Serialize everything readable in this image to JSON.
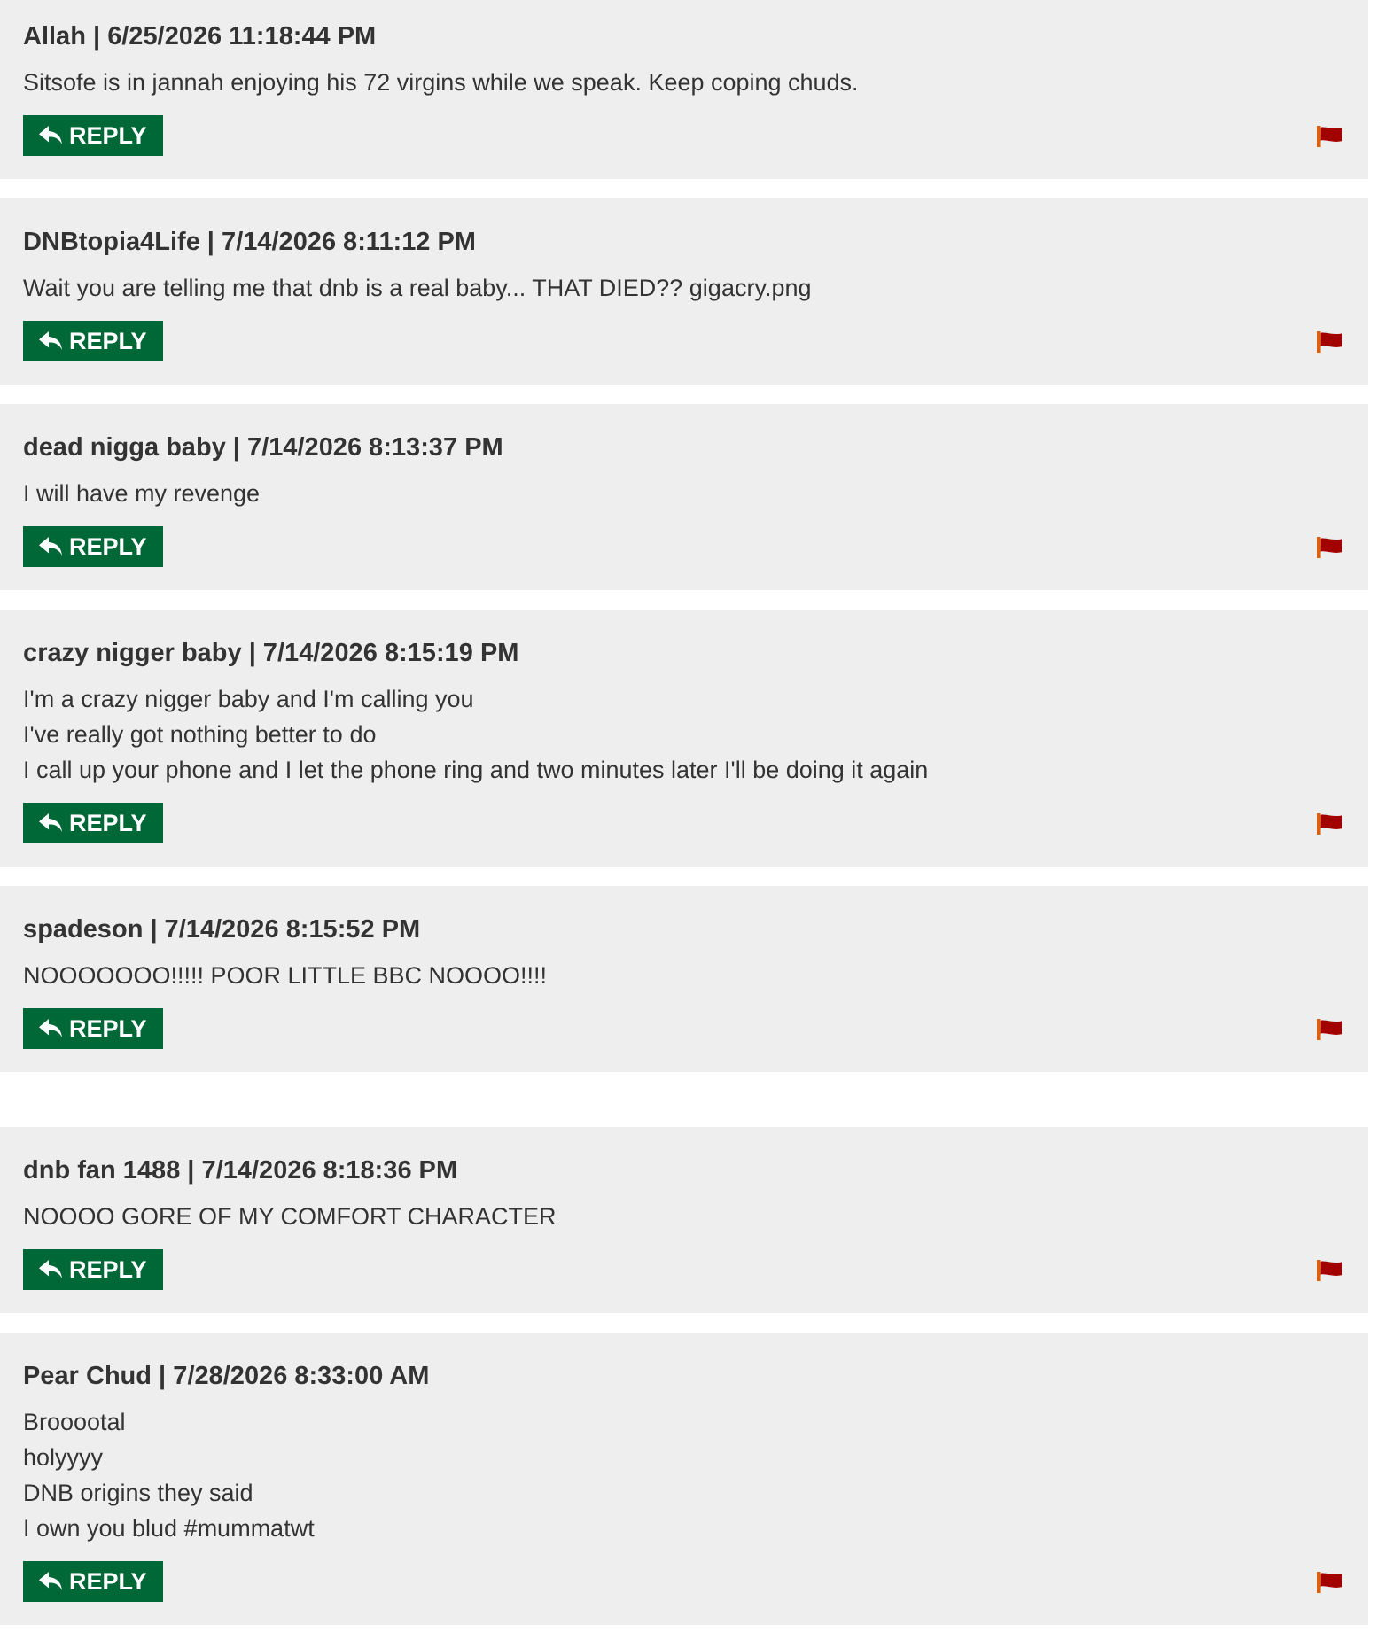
{
  "comments": [
    {
      "header": "Allah | 6/25/2026 11:18:44 PM",
      "lines": [
        "Sitsofe is in jannah enjoying his 72 virgins while we speak. Keep coping chuds."
      ],
      "reply_label": "REPLY"
    },
    {
      "header": "DNBtopia4Life | 7/14/2026 8:11:12 PM",
      "lines": [
        "Wait you are telling me that dnb is a real baby... THAT DIED?? gigacry.png"
      ],
      "reply_label": "REPLY"
    },
    {
      "header": "dead nigga baby | 7/14/2026 8:13:37 PM",
      "lines": [
        "I will have my revenge"
      ],
      "reply_label": "REPLY"
    },
    {
      "header": "crazy nigger baby | 7/14/2026 8:15:19 PM",
      "lines": [
        "I'm a crazy nigger baby and I'm calling you",
        "I've really got nothing better to do",
        "I call up your phone and I let the phone ring and two minutes later I'll be doing it again"
      ],
      "reply_label": "REPLY"
    },
    {
      "header": "spadeson | 7/14/2026 8:15:52 PM",
      "lines": [
        "NOOOOOOO!!!!! POOR LITTLE BBC NOOOO!!!!"
      ],
      "reply_label": "REPLY"
    },
    {
      "header": "dnb fan 1488 | 7/14/2026 8:18:36 PM",
      "lines": [
        "NOOOO GORE OF MY COMFORT CHARACTER"
      ],
      "reply_label": "REPLY"
    },
    {
      "header": "Pear Chud | 7/28/2026 8:33:00 AM",
      "lines": [
        "Brooootal",
        "holyyyy",
        "DNB origins they said",
        "I own you blud #mummatwt"
      ],
      "reply_label": "REPLY"
    }
  ]
}
